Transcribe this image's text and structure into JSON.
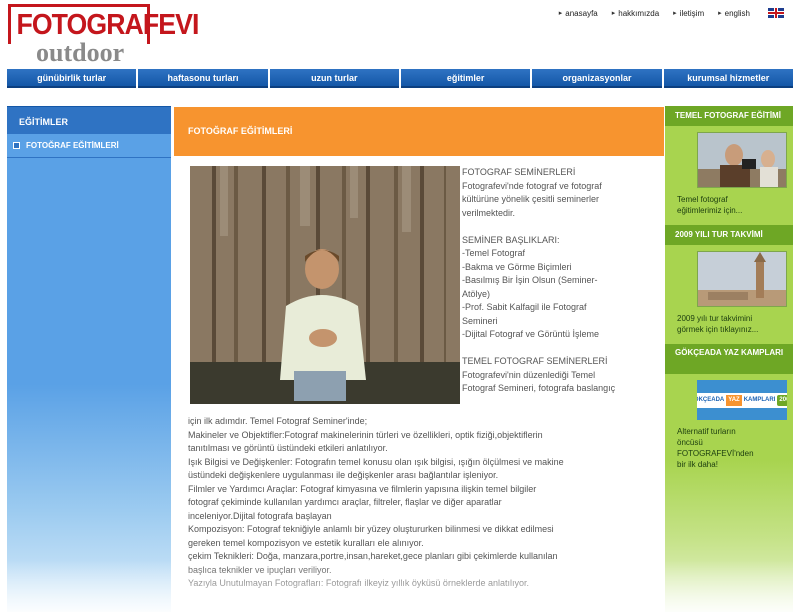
{
  "logo": {
    "top": "FOTOGRAFEVI",
    "bottom": "outdoor"
  },
  "top_links": [
    "anasayfa",
    "hakkımızda",
    "iletişim",
    "english"
  ],
  "nav": [
    "günübirlik turlar",
    "haftasonu turları",
    "uzun turlar",
    "eğitimler",
    "organizasyonlar",
    "kurumsal hizmetler"
  ],
  "left": {
    "title": "EĞİTİMLER",
    "items": [
      "FOTOĞRAF EĞİTİMLERİ"
    ]
  },
  "main": {
    "title": "FOTOĞRAF EĞİTİMLERİ",
    "side_lines": [
      "FOTOGRAF SEMİNERLERİ",
      "Fotografevi'nde fotograf ve fotograf",
      "kültürüne yönelik çesitli seminerler",
      "verilmektedir.",
      "",
      "SEMİNER BAŞLIKLARI:",
      "-Temel Fotograf",
      "-Bakma ve Görme Biçimleri",
      "-Basılmış Bir İşin Olsun (Seminer-",
      "Atölye)",
      "-Prof. Sabit Kalfagil ile Fotograf",
      "Semineri",
      "-Dijital Fotograf ve Görüntü İşleme",
      "",
      "TEMEL FOTOGRAF SEMİNERLERİ",
      "Fotografevi'nin düzenlediği Temel",
      "Fotograf Semineri, fotografa baslangıç"
    ],
    "body_lines": [
      "için ilk adımdır. Temel Fotograf Seminer'inde;",
      "Makineler ve Objektifler:Fotograf makinelerinin türleri ve özellikleri, optik fiziği,objektiflerin",
      "tanıtılması ve görüntü üstündeki etkileri anlatılıyor.",
      "Işık Bilgisi ve Değişkenler: Fotografın temel konusu olan ışık bilgisi, ışığın ölçülmesi ve makine",
      "üstündeki değişkenlere uygulanması ile değişkenler arası bağlantılar işleniyor.",
      "Filmler ve Yardımcı Araçlar: Fotograf kimyasına ve filmlerin yapısına ilişkin temel bilgiler",
      "fotograf çekiminde kullanılan yardımcı araçlar, filtreler, flaşlar ve diğer aparatlar",
      "inceleniyor.Dijital fotografa başlayan",
      "Kompozisyon: Fotograf tekniğiyle anlamlı bir yüzey oluştururken bilinmesi ve dikkat edilmesi",
      "gereken temel kompozisyon ve estetik kuralları ele alınıyor.",
      "çekim Teknikleri: Doğa, manzara,portre,insan,hareket,gece planları gibi çekimlerde kullanılan",
      "başlıca teknikler ve ipuçları veriliyor.",
      "Yazıyla Unutulmayan Fotografları: Fotografı ilkeyiz yıllık öyküsü örneklerde anlatılıyor."
    ]
  },
  "right": {
    "sections": [
      {
        "title": "TEMEL FOTOGRAF EĞİTİMİ",
        "text": [
          "Temel fotograf",
          "eğitimlerimiz için..."
        ]
      },
      {
        "title": "2009 YILI TUR TAKVİMİ",
        "text": [
          "2009 yılı tur takvimini",
          "görmek için tıklayınız..."
        ]
      },
      {
        "title": "GÖKÇEADA YAZ KAMPLARI",
        "text": [
          "Alternatif turların",
          "öncüsü",
          "FOTOGRAFEVİ'nden",
          "bir ilk daha!"
        ],
        "banner": [
          "GÖKÇEADA",
          "YAZ",
          "KAMPLARI",
          "2009"
        ]
      }
    ]
  },
  "colors": {
    "nav": "#1e64b4",
    "left": "#5aa1e6",
    "main_header": "#f7942f",
    "right": "#a8d44f",
    "logo": "#c4161c"
  }
}
